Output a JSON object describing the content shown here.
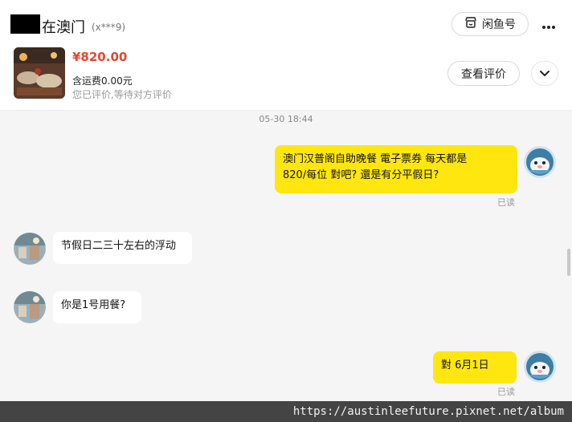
{
  "header": {
    "title": "在澳门",
    "masked_id": "(x***9)",
    "xianyu_button": "闲鱼号",
    "more_icon": "more-horizontal-icon"
  },
  "product": {
    "price": "¥820.00",
    "shipping": "含运费0.00元",
    "review_status": "您已评价,等待对方评价",
    "review_button": "查看评价",
    "expand_icon": "chevron-down-icon"
  },
  "chat": {
    "timestamp": "05-30 18:44",
    "messages": [
      {
        "from": "me",
        "lines": [
          "澳门汉普阁自助晚餐  電子票券  每天都是",
          "820/每位  對吧?  還是有分平假日?"
        ],
        "status": "已读"
      },
      {
        "from": "them",
        "text": "节假日二三十左右的浮动"
      },
      {
        "from": "them",
        "text": "你是1号用餐?"
      },
      {
        "from": "me",
        "text": "對    6月1日",
        "status": "已读"
      }
    ]
  },
  "watermark": "https://austinleefuture.pixnet.net/album",
  "colors": {
    "accent_yellow": "#ffe60f",
    "price_red": "#e8452c",
    "background": "#f5f5f5"
  }
}
